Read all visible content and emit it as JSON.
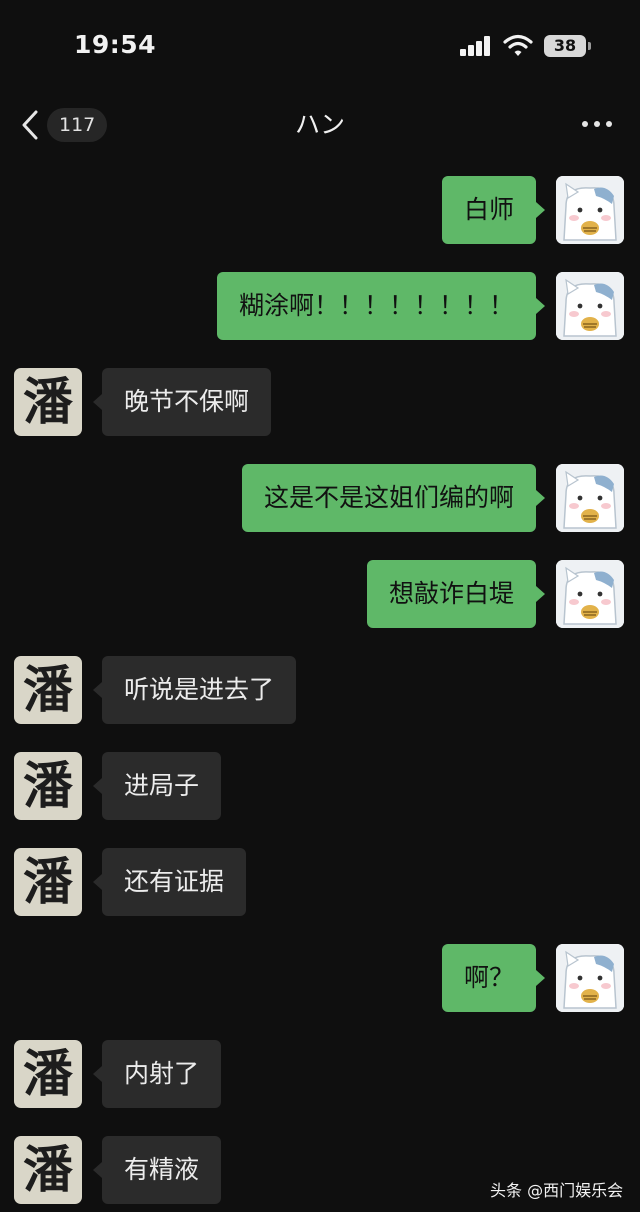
{
  "status_bar": {
    "time": "19:54",
    "battery": "38"
  },
  "header": {
    "unread_count": "117",
    "title": "ハン"
  },
  "avatar_other_glyph": "潘",
  "messages": [
    {
      "sender": "self",
      "text": "白师"
    },
    {
      "sender": "self",
      "text": "糊涂啊！！！！！！！！"
    },
    {
      "sender": "other",
      "text": "晚节不保啊"
    },
    {
      "sender": "self",
      "text": "这是不是这姐们编的啊"
    },
    {
      "sender": "self",
      "text": "想敲诈白堤"
    },
    {
      "sender": "other",
      "text": "听说是进去了"
    },
    {
      "sender": "other",
      "text": "进局子"
    },
    {
      "sender": "other",
      "text": "还有证据"
    },
    {
      "sender": "self",
      "text": "啊？"
    },
    {
      "sender": "other",
      "text": "内射了"
    },
    {
      "sender": "other",
      "text": "有精液"
    }
  ],
  "watermark": "头条 @西门娱乐会"
}
